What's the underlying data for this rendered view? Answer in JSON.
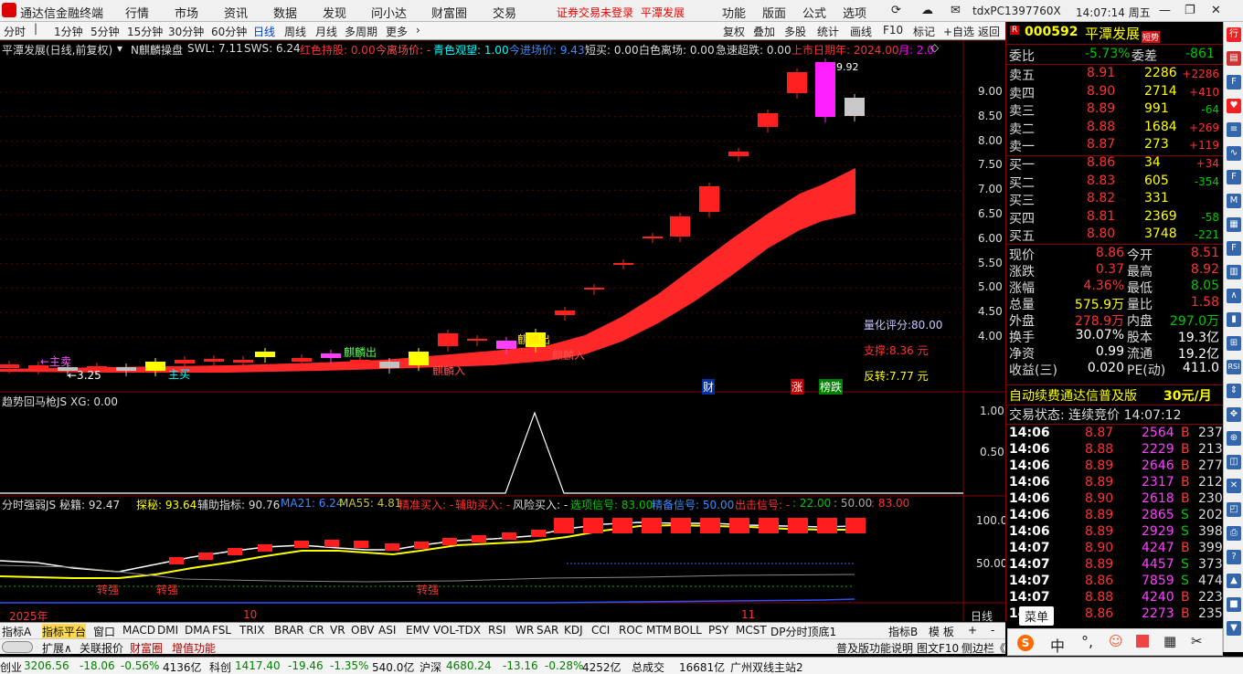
{
  "title": {
    "app": "通达信金融终端",
    "menus": [
      "行情",
      "市场",
      "资讯",
      "数据",
      "发现",
      "问小达",
      "财富圈",
      "交易"
    ],
    "notice1": "证券交易未登录",
    "notice2": "平潭发展",
    "right_menus": [
      "功能",
      "版面",
      "公式",
      "选项"
    ],
    "user": "tdxPC1397760X",
    "time": "14:07:14 周五"
  },
  "toolbar": {
    "periods": [
      "分时",
      "1分钟",
      "5分钟",
      "15分钟",
      "30分钟",
      "60分钟",
      "日线",
      "周线",
      "月线",
      "多周期",
      "更多"
    ],
    "actions": [
      "复权",
      "叠加",
      "多股",
      "统计",
      "画线",
      "F10",
      "标记",
      "+自选",
      "返回"
    ]
  },
  "main_header": {
    "name": "平潭发展(日线,前复权)",
    "ind": "N麒麟操盘",
    "swl": "SWL: 7.11",
    "sws": "SWS: 6.24",
    "hong": "红色持股: 0.00",
    "jinli": "今离场价: -",
    "qing": "青色观望: 1.00",
    "jinjin": "今进场价: 9.43",
    "duan": "短买: 0.00",
    "bai": "白色离场: 0.00",
    "ji": "急速超跌: 0.00",
    "shang": "上市日期年: 2024.00",
    "yue": "月: 2.0"
  },
  "main_labels": {
    "zhumai": "←主卖",
    "low": "←3.25",
    "zhumai2": "主买",
    "qilin1": "麒麟入",
    "qilin2": "麒麟入",
    "qilin3": "麒麟出",
    "qilin4": "麒麟出",
    "hmax": "9.92",
    "score": "量化评分:80.00",
    "support": "支撑:8.36 元",
    "reverse": "反转:7.77 元",
    "cai": "财",
    "zhang": "涨",
    "bang": "榜跌"
  },
  "main_axis": [
    "9.00",
    "8.50",
    "8.00",
    "7.50",
    "7.00",
    "6.50",
    "6.00",
    "5.50",
    "5.00",
    "4.50",
    "4.00"
  ],
  "ind1": {
    "header": "趋势回马枪JS  XG: 0.00",
    "axis": [
      "1.00",
      "0.50"
    ]
  },
  "ind2": {
    "header_a": "分时强弱JS  秘籍: 92.47",
    "header_b": "探秘: 93.64",
    "header_c": "辅助指标: 90.76",
    "header_d": "MA21: 6.24",
    "header_e": "MA55: 4.81",
    "header_f": "精准买入: -",
    "header_g": "辅助买入: -",
    "header_h": "风险买入: -",
    "header_i": "选项信号: 83.00",
    "header_j": "精备信号: 50.00",
    "header_k": "出击信号: -",
    "header_l": ": 22.00",
    "header_m": ": 50.00",
    "header_n": ": 83.00",
    "axis": [
      "100.0",
      "50.00"
    ],
    "tags": [
      "转强",
      "转强",
      "转强"
    ]
  },
  "xaxis": {
    "y2025": "2025年",
    "m10": "10",
    "m11": "11",
    "period": "日线"
  },
  "ind_tabs": [
    "指标A",
    "指标平台",
    "窗口",
    "MACD",
    "DMI",
    "DMA",
    "FSL",
    "TRIX",
    "BRAR",
    "CR",
    "VR",
    "OBV",
    "ASI",
    "EMV",
    "VOL-TDX",
    "RSI",
    "WR",
    "SAR",
    "KDJ",
    "CCI",
    "ROC",
    "MTM",
    "BOLL",
    "PSY",
    "MCST",
    "DP分时顶底1",
    "指标B",
    "模 板",
    "+",
    "-"
  ],
  "sub_tabs": [
    "扩展∧",
    "关联报价",
    "财富圈",
    "增值功能"
  ],
  "sub_right": [
    "普及版功能说明",
    "图文F10",
    "侧边栏《"
  ],
  "quote": {
    "code": "000592",
    "name": "平潭发展",
    "tag": "短势",
    "weibi": "委比",
    "weibi_v": "-5.73%",
    "weicha": "委差",
    "weicha_v": "-861",
    "sells": [
      {
        "l": "卖五",
        "p": "8.91",
        "v": "2286",
        "c": "+2286"
      },
      {
        "l": "卖四",
        "p": "8.90",
        "v": "2714",
        "c": "+410"
      },
      {
        "l": "卖三",
        "p": "8.89",
        "v": "991",
        "c": "-64"
      },
      {
        "l": "卖二",
        "p": "8.88",
        "v": "1684",
        "c": "+269"
      },
      {
        "l": "卖一",
        "p": "8.87",
        "v": "273",
        "c": "+119"
      }
    ],
    "buys": [
      {
        "l": "买一",
        "p": "8.86",
        "v": "34",
        "c": "+34"
      },
      {
        "l": "买二",
        "p": "8.83",
        "v": "605",
        "c": "-354"
      },
      {
        "l": "买三",
        "p": "8.82",
        "v": "331",
        "c": ""
      },
      {
        "l": "买四",
        "p": "8.81",
        "v": "2369",
        "c": "-58"
      },
      {
        "l": "买五",
        "p": "8.80",
        "v": "3748",
        "c": "-221"
      }
    ],
    "stats": [
      [
        "现价",
        "8.86",
        "今开",
        "8.51"
      ],
      [
        "涨跌",
        "0.37",
        "最高",
        "8.92"
      ],
      [
        "涨幅",
        "4.36%",
        "最低",
        "8.05"
      ],
      [
        "总量",
        "575.9万",
        "量比",
        "1.58"
      ],
      [
        "外盘",
        "278.9万",
        "内盘",
        "297.0万"
      ],
      [
        "换手",
        "30.07%",
        "股本",
        "19.3亿"
      ],
      [
        "净资",
        "0.99",
        "流通",
        "19.2亿"
      ],
      [
        "收益(三)",
        "0.020",
        "PE(动)",
        "411.0"
      ]
    ],
    "promo": "自动续费通达信普及版",
    "promo_price": "30元/月",
    "status": "交易状态: 连续竞价 14:07:12",
    "ticks": [
      [
        "14:06",
        "8.87",
        "2564",
        "B",
        "237"
      ],
      [
        "14:06",
        "8.88",
        "2229",
        "B",
        "213"
      ],
      [
        "14:06",
        "8.89",
        "2646",
        "B",
        "277"
      ],
      [
        "14:06",
        "8.89",
        "2317",
        "B",
        "212"
      ],
      [
        "14:06",
        "8.90",
        "2618",
        "B",
        "230"
      ],
      [
        "14:06",
        "8.89",
        "2865",
        "S",
        "202"
      ],
      [
        "14:06",
        "8.89",
        "2929",
        "S",
        "398"
      ],
      [
        "14:07",
        "8.90",
        "4247",
        "B",
        "399"
      ],
      [
        "14:07",
        "8.89",
        "4457",
        "S",
        "373"
      ],
      [
        "14:07",
        "8.86",
        "7859",
        "S",
        "474"
      ],
      [
        "14:07",
        "8.88",
        "4240",
        "B",
        "223"
      ],
      [
        "14:07",
        "8.86",
        "2273",
        "B",
        "235"
      ]
    ],
    "menu": "菜单"
  },
  "status": {
    "cyb": "创业",
    "cyb_v": "3206.56",
    "cyb_c": "-18.06",
    "cyb_p": "-0.56%",
    "cyb_a": "4136亿",
    "kc": "科创",
    "kc_v": "1417.40",
    "kc_c": "-19.46",
    "kc_p": "-1.35%",
    "kc_a": "540.0亿",
    "hs": "沪深",
    "hs_v": "4680.24",
    "hs_c": "-13.16",
    "hs_p": "-0.28%",
    "hs_a": "4252亿",
    "zcj": "总成交",
    "zcj_v": "16681亿",
    "station": "广州双线主站2"
  },
  "colors": {
    "up": "#ff3232",
    "down": "#00c800",
    "band": "#ff2828",
    "candle_up": "#ff2020"
  }
}
